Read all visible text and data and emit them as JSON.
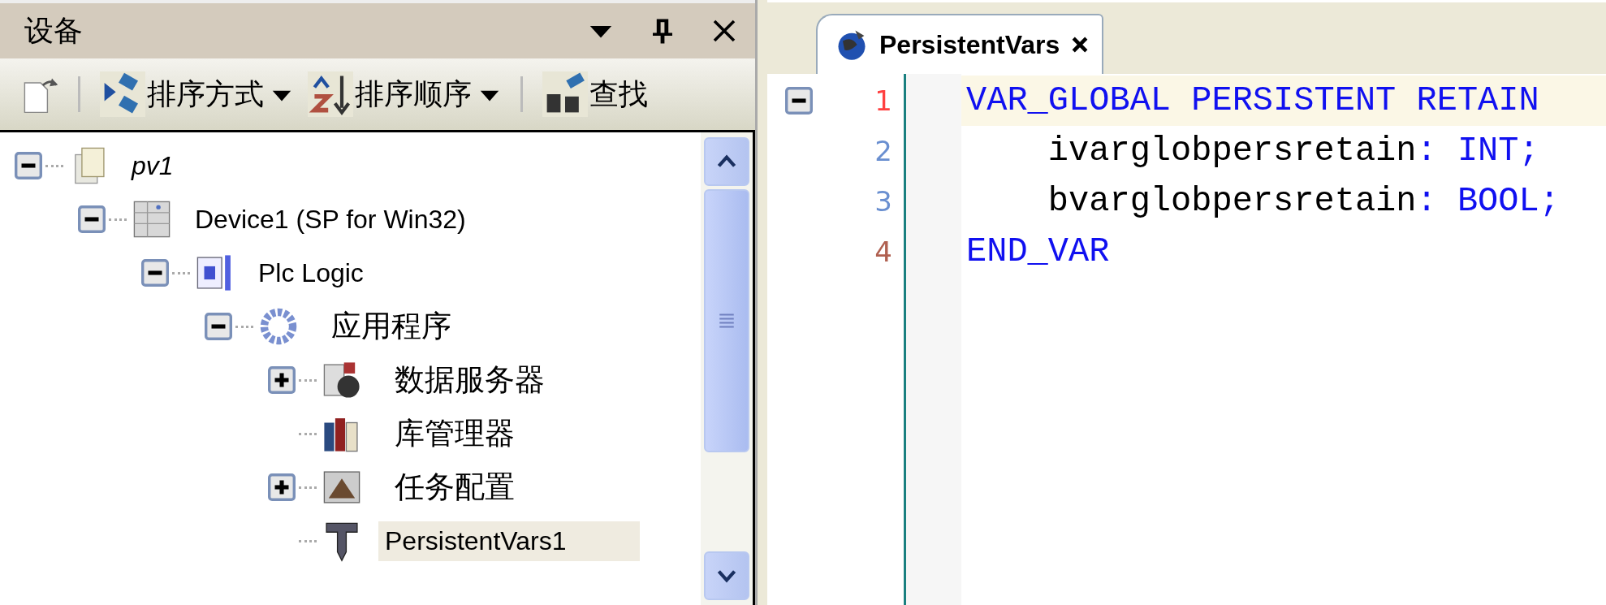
{
  "panel": {
    "title": "设备"
  },
  "toolbar": [
    {
      "kind": "new"
    },
    {
      "kind": "separator"
    },
    {
      "kind": "sort-by",
      "label": "排序方式"
    },
    {
      "kind": "sort-order",
      "label": "排序顺序"
    },
    {
      "kind": "separator"
    },
    {
      "kind": "find",
      "label": "查找"
    }
  ],
  "tree": [
    {
      "label": "pv1",
      "kind": "project",
      "expanded": true,
      "selected": false,
      "children": [
        {
          "label": "Device1 (SP for Win32)",
          "kind": "device",
          "expanded": true,
          "selected": false,
          "children": [
            {
              "label": "Plc Logic",
              "kind": "plc-logic",
              "expanded": true,
              "selected": false,
              "children": [
                {
                  "label": "应用程序",
                  "kind": "application",
                  "expanded": true,
                  "selected": false,
                  "children": [
                    {
                      "label": "数据服务器",
                      "kind": "data-server",
                      "expanded": false,
                      "selected": false
                    },
                    {
                      "label": "库管理器",
                      "kind": "library",
                      "selected": false
                    },
                    {
                      "label": "任务配置",
                      "kind": "task-config",
                      "expanded": false,
                      "selected": false
                    },
                    {
                      "label": "PersistentVars1",
                      "kind": "gvl",
                      "selected": true
                    }
                  ]
                }
              ]
            }
          ]
        }
      ]
    }
  ],
  "editor": {
    "tab": {
      "title": "PersistentVars",
      "selected": true
    },
    "lines": [
      {
        "number": "1",
        "color": "#ff4040",
        "current": true,
        "kind": "fold-start",
        "segments": [
          {
            "text": "VAR_GLOBAL PERSISTENT RETAIN",
            "kind": "keyword"
          }
        ]
      },
      {
        "number": "2",
        "color": "#6a8fd0",
        "current": false,
        "kind": "plain",
        "segments": [
          {
            "text": "    ivarglobpersretain",
            "kind": "plain"
          },
          {
            "text": ": INT;",
            "kind": "keyword"
          }
        ]
      },
      {
        "number": "3",
        "color": "#6a8fd0",
        "current": false,
        "kind": "plain",
        "segments": [
          {
            "text": "    bvarglobpersretain",
            "kind": "plain"
          },
          {
            "text": ": BOOL;",
            "kind": "keyword"
          }
        ]
      },
      {
        "number": "4",
        "color": "#b06050",
        "current": false,
        "kind": "plain",
        "segments": [
          {
            "text": "END_VAR",
            "kind": "keyword"
          }
        ]
      }
    ]
  }
}
